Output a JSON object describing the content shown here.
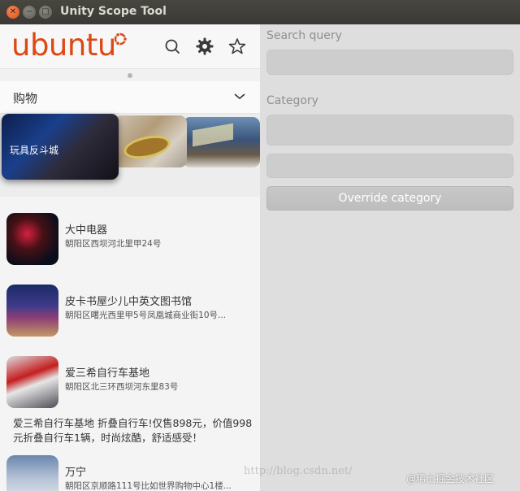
{
  "window": {
    "title": "Unity Scope Tool",
    "close_glyph": "✕",
    "minimize_glyph": "−",
    "maximize_glyph": "□"
  },
  "scope": {
    "logo_text": "ubuntu",
    "header_icons": [
      "search-icon",
      "gear-icon",
      "star-icon"
    ],
    "department": "购物",
    "carousel": [
      {
        "label": "玩具反斗城"
      }
    ],
    "results": [
      {
        "name": "大中电器",
        "address": "朝阳区西坝河北里甲24号"
      },
      {
        "name": "皮卡书屋少儿中英文图书馆",
        "address": "朝阳区曙光西里甲5号凤凰城商业街10号..."
      },
      {
        "name": "爱三希自行车基地",
        "address": "朝阳区北三环西坝河东里83号",
        "description": "爱三希自行车基地 折叠自行车!仅售898元，价值998元折叠自行车1辆，时尚炫酷，舒适感受！"
      },
      {
        "name": "万宁",
        "address": "朝阳区京顺路111号比如世界购物中心1楼..."
      }
    ]
  },
  "controls": {
    "search_query_label": "Search query",
    "search_query_value": "",
    "category_label": "Category",
    "category_value": "",
    "category_value_2": "",
    "override_button": "Override category"
  },
  "watermark": {
    "url": "http://blog.csdn.net/",
    "credit": "@稀土掘金技术社区"
  },
  "colors": {
    "brand_orange": "#dd4814",
    "titlebar": "#3c3b37",
    "right_panel": "#dedede"
  }
}
